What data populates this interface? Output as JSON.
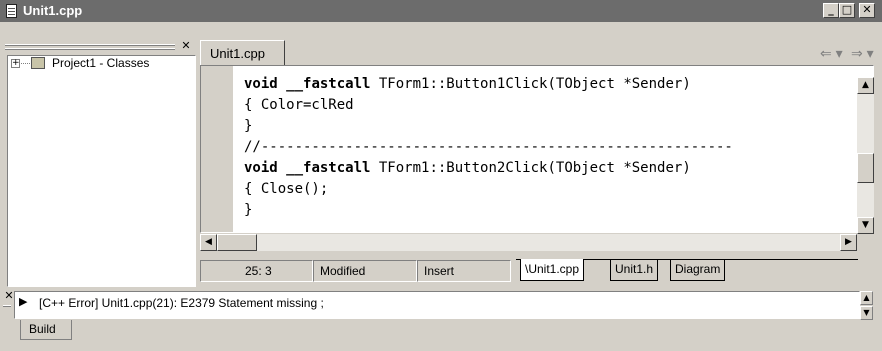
{
  "window": {
    "title": "Unit1.cpp"
  },
  "explorer": {
    "root_label": "Project1 - Classes",
    "expand_glyph": "+"
  },
  "editor": {
    "tab_label": "Unit1.cpp",
    "nav_back": "⇐ ▾",
    "nav_forward": "⇒ ▾",
    "code_lines": [
      {
        "kw1": "void",
        "kw2": "__fastcall",
        "rest": " TForm1::Button1Click(TObject *Sender)"
      },
      {
        "text": "{ Color=clRed"
      },
      {
        "text": "}"
      },
      {
        "text": "//--------------------------------------------------------"
      },
      {
        "kw1": "void",
        "kw2": "__fastcall",
        "rest": " TForm1::Button2Click(TObject *Sender)"
      },
      {
        "text": "{ Close();"
      },
      {
        "text": "}"
      }
    ]
  },
  "status": {
    "position": "25:  3",
    "modified": "Modified",
    "mode": "Insert",
    "file_tabs": [
      "\\Unit1.cpp",
      "Unit1.h",
      "Diagram"
    ]
  },
  "messages": {
    "items": [
      "[C++ Error] Unit1.cpp(21): E2379 Statement missing ;"
    ],
    "tab_label": "Build"
  },
  "colors": {
    "titlebar": "#6c6c6c",
    "chrome": "#d4d0c8"
  }
}
